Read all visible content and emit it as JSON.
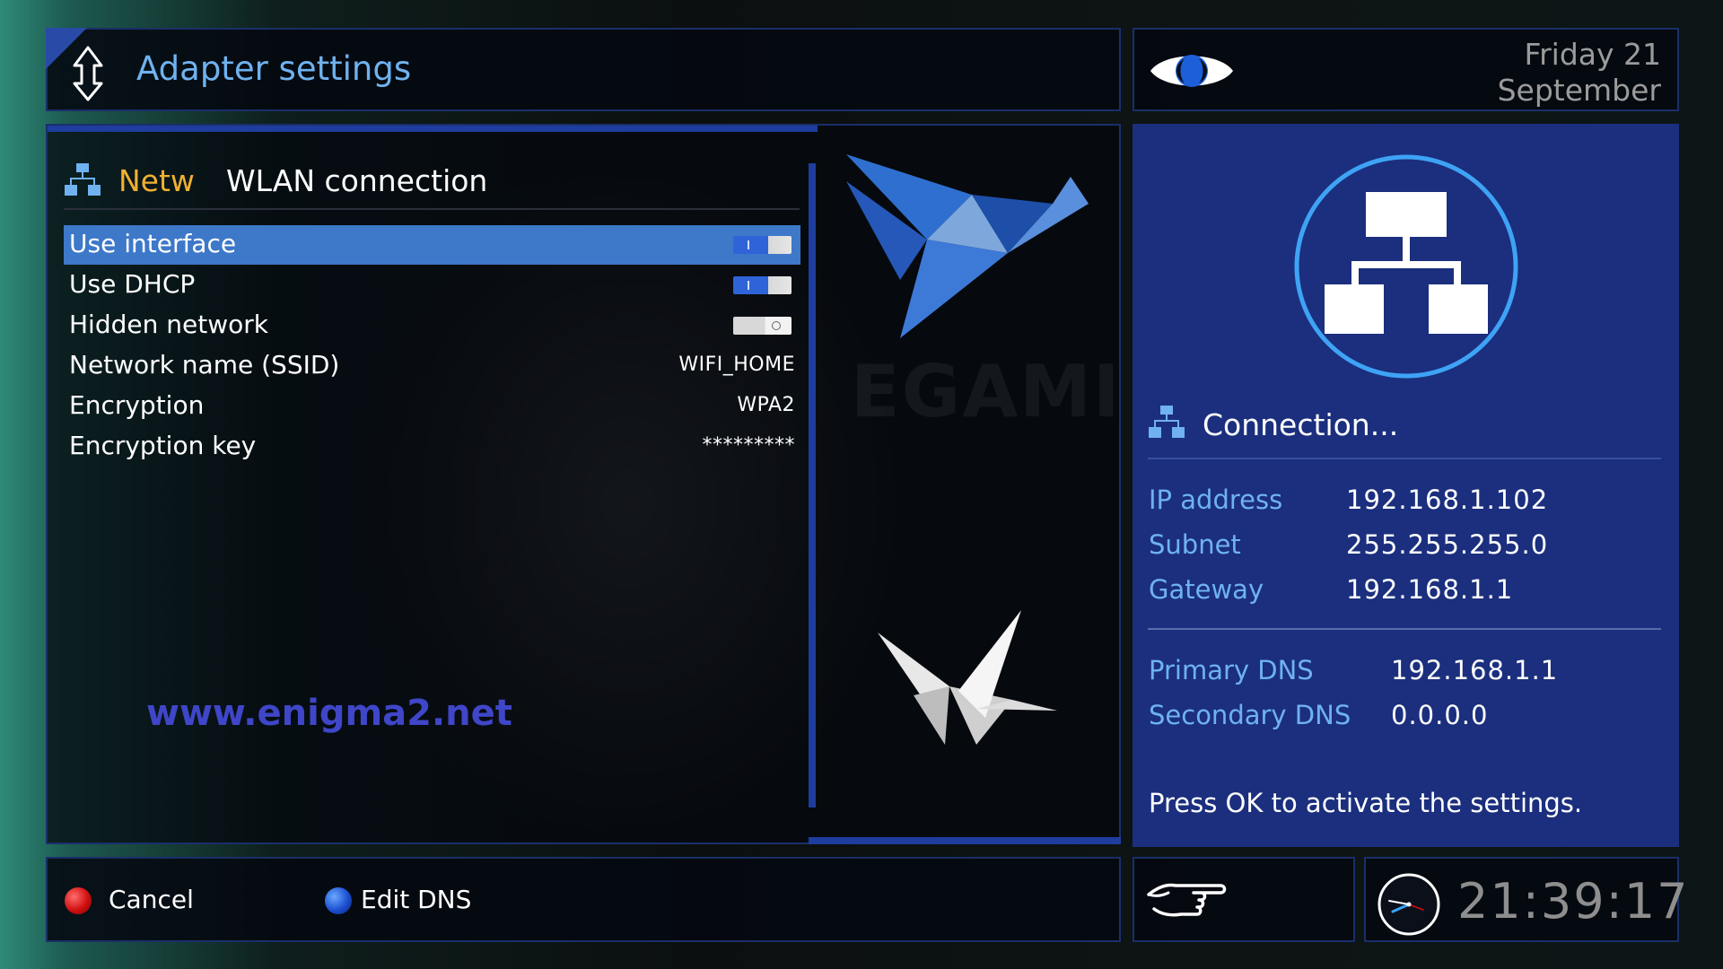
{
  "header": {
    "title": "Adapter settings",
    "updown_icon": "up-down-arrow-icon"
  },
  "date": {
    "line1": "Friday 21",
    "line2": "September"
  },
  "section": {
    "prefix": "Netw",
    "title": "WLAN connection",
    "icon": "network-tree-icon"
  },
  "settings": [
    {
      "label": "Use interface",
      "type": "toggle",
      "state": "on",
      "selected": true
    },
    {
      "label": "Use DHCP",
      "type": "toggle",
      "state": "on",
      "selected": false
    },
    {
      "label": "Hidden network",
      "type": "toggle",
      "state": "off",
      "selected": false
    },
    {
      "label": "Network name (SSID)",
      "type": "text",
      "value": "WIFI_HOME",
      "selected": false
    },
    {
      "label": "Encryption",
      "type": "text",
      "value": "WPA2",
      "selected": false
    },
    {
      "label": "Encryption key",
      "type": "text",
      "value": "*********",
      "selected": false
    }
  ],
  "watermark": "www.enigma2.net",
  "brand_watermark": "EGAMI",
  "info": {
    "title": "Connection...",
    "ip_label": "IP address",
    "ip_value": "192.168.1.102",
    "subnet_label": "Subnet",
    "subnet_value": "255.255.255.0",
    "gateway_label": "Gateway",
    "gateway_value": "192.168.1.1",
    "dns1_label": "Primary DNS",
    "dns1_value": "192.168.1.1",
    "dns2_label": "Secondary DNS",
    "dns2_value": "0.0.0.0",
    "hint": "Press OK to activate the settings."
  },
  "footer": {
    "red_label": "Cancel",
    "blue_label": "Edit DNS"
  },
  "clock": {
    "time": "21:39:17"
  },
  "colors": {
    "accent_blue": "#6fb2ef",
    "selection": "#3d78c9",
    "panel_blue": "#1b2f7e",
    "section_prefix": "#f0b030",
    "watermark": "#3f46c8",
    "key_red": "#d01010",
    "key_blue": "#1c4fd0"
  },
  "icons": [
    "up-down-arrow-icon",
    "eye-logo-icon",
    "network-tree-icon",
    "hand-pointer-icon",
    "analog-clock-icon",
    "bird-graphic",
    "paper-crane-graphic"
  ]
}
